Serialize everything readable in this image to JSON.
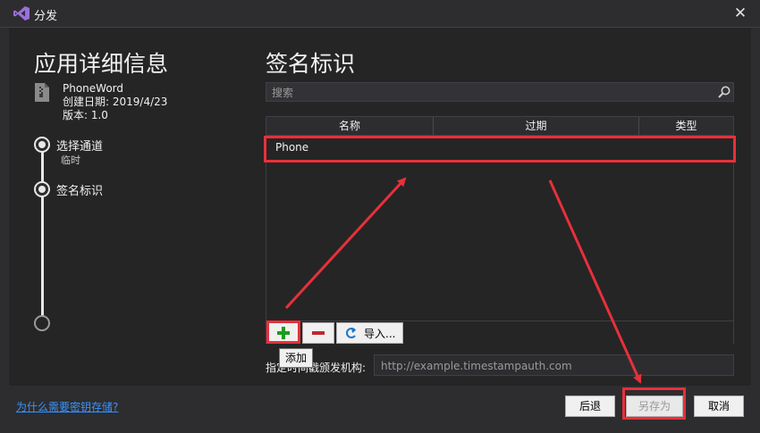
{
  "window": {
    "title": "分发",
    "close_glyph": "✕"
  },
  "left": {
    "title": "应用详细信息",
    "app_name": "PhoneWord",
    "created": "创建日期: 2019/4/23",
    "version": "版本: 1.0",
    "steps": [
      {
        "label": "选择通道",
        "sub": "临时"
      },
      {
        "label": "签名标识"
      }
    ]
  },
  "right": {
    "title": "签名标识",
    "search_placeholder": "搜索",
    "columns": [
      "名称",
      "过期",
      "类型"
    ],
    "rows": [
      {
        "name": "Phone",
        "expires": "",
        "type": ""
      }
    ],
    "add_glyph": "+",
    "remove_glyph": "−",
    "import_label": "导入...",
    "tooltip": "添加",
    "tsa_label": "指定时间戳颁发机构:",
    "tsa_placeholder": "http://example.timestampauth.com"
  },
  "footer": {
    "help_link": "为什么需要密钥存储?",
    "back": "后退",
    "save_as": "另存为",
    "cancel": "取消"
  },
  "colors": {
    "accent_red": "#e8303a",
    "add_green": "#1e9b1e",
    "remove_red": "#c0282f",
    "link_blue": "#3794ff"
  }
}
